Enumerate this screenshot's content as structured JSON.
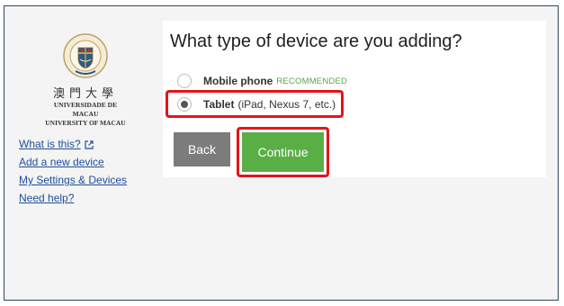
{
  "sidebar": {
    "logo": {
      "chinese_name": "澳門大學",
      "portuguese_name": "UNIVERSIDADE DE MACAU",
      "english_name": "UNIVERSITY OF MACAU"
    },
    "links": [
      {
        "label": "What is this?",
        "icon": "external-link-icon"
      },
      {
        "label": "Add a new device"
      },
      {
        "label": "My Settings & Devices"
      },
      {
        "label": "Need help?"
      }
    ]
  },
  "main": {
    "title": "What type of device are you adding?",
    "options": [
      {
        "label": "Mobile phone",
        "badge": "RECOMMENDED",
        "selected": false
      },
      {
        "label": "Tablet",
        "description": "(iPad, Nexus 7, etc.)",
        "selected": true
      }
    ],
    "buttons": {
      "back": "Back",
      "continue": "Continue"
    }
  },
  "colors": {
    "continue_button": "#5aae46",
    "back_button": "#7c7c7c",
    "highlight": "#e4141b",
    "link": "#1d4e9b",
    "recommended": "#5aa44a"
  }
}
